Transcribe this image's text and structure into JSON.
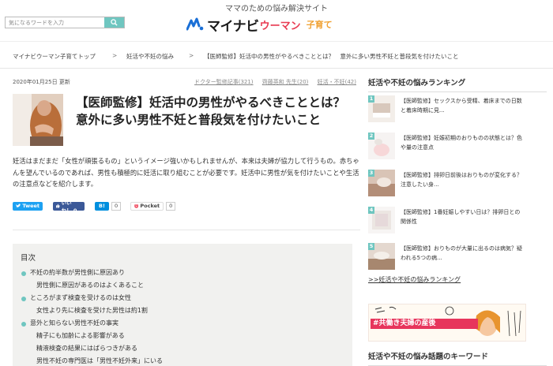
{
  "header": {
    "tagline": "ママのための悩み解決サイト",
    "search_placeholder": "気になるワードを入力",
    "logo_main": "マイナビ",
    "logo_sub": "ウーマン",
    "logo_kosodate": "子育て",
    "brand_color": "#6fc6c0"
  },
  "breadcrumb": {
    "items": [
      "マイナビウーマン子育てトップ",
      "妊活や不妊の悩み",
      "【医師監修】妊活中の男性がやるべきこととは？　意外に多い男性不妊と普段気を付けたいこと"
    ],
    "separator": ">"
  },
  "article": {
    "date": "2020年01月25日 更新",
    "tags": [
      "ドクター監修記事(321)",
      "齊藤英和 先生(20)",
      "妊活・不妊(42)"
    ],
    "title": "【医師監修】妊活中の男性がやるべきこととは？　意外に多い男性不妊と普段気を付けたいこと",
    "intro": "妊活はまだまだ「女性が頑張るもの」というイメージ強いかもしれませんが、本来は夫婦が協力して行うもの。赤ちゃんを望んでいるのであれば、男性も積極的に妊活に取り組むことが必要です。妊活中に男性が気を付けたいことや生活の注意点などを紹介します。"
  },
  "share": {
    "tweet": "Tweet",
    "like": "いいね！ 0",
    "hatena": "B!",
    "hatena_count": "0",
    "pocket": "Pocket",
    "pocket_count": "0"
  },
  "toc": {
    "title": "目次",
    "items": [
      {
        "text": "不妊の約半数が男性側に原因あり",
        "level": 1
      },
      {
        "text": "男性側に原因があるのはよくあること",
        "level": 2
      },
      {
        "text": "ところがまず検査を受けるのは女性",
        "level": 1
      },
      {
        "text": "女性より先に検査を受けた男性は約1割",
        "level": 2
      },
      {
        "text": "意外と知らない男性不妊の事実",
        "level": 1
      },
      {
        "text": "精子にも加齢による影響がある",
        "level": 2
      },
      {
        "text": "精液検査の結果にはばらつきがある",
        "level": 2
      },
      {
        "text": "男性不妊の専門医は「男性不妊外来」にいる",
        "level": 2
      }
    ]
  },
  "sidebar": {
    "ranking_title": "妊活や不妊の悩みランキング",
    "ranking": [
      {
        "num": "1",
        "text": "【医師監修】セックスから受精、着床までの日数と着床時期に見..."
      },
      {
        "num": "2",
        "text": "【医師監修】妊娠初期のおりものの状態とは？色や量の注意点"
      },
      {
        "num": "3",
        "text": "【医師監修】排卵日前後はおりものが変化する？ 注意したい身..."
      },
      {
        "num": "4",
        "text": "【医師監修】1番妊娠しやすい日は？排卵日との関係性"
      },
      {
        "num": "5",
        "text": "【医師監修】おりものが大量に出るのは病気？疑われる5つの病..."
      }
    ],
    "ranking_link": ">>妊活や不妊の悩みランキング",
    "banner_text": "#共働き夫婦の産後",
    "keyword_title": "妊活や不妊の悩み話題のキーワード"
  }
}
